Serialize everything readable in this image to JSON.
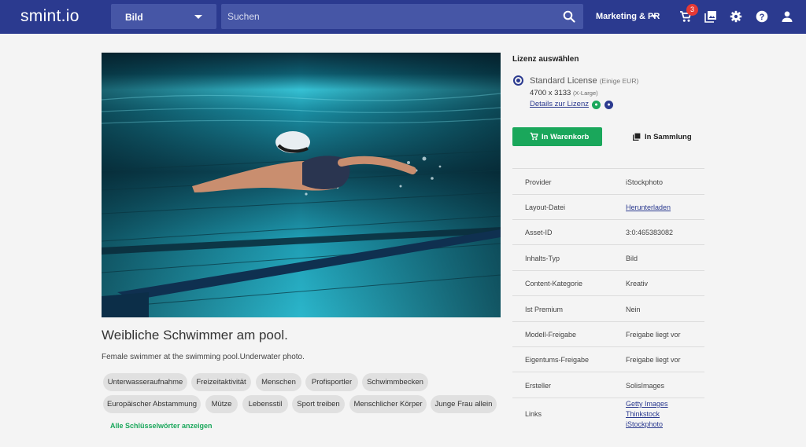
{
  "header": {
    "logo": "smint.io",
    "type_select": "Bild",
    "search_placeholder": "Suchen",
    "workspace": "Marketing & PR",
    "cart_count": "3"
  },
  "asset": {
    "title": "Weibliche Schwimmer am pool.",
    "description": "Female swimmer at the swimming pool.Underwater photo.",
    "keywords": [
      "Unterwasseraufnahme",
      "Freizeitaktivität",
      "Menschen",
      "Profisportler",
      "Schwimmbecken",
      "Europäischer Abstammung",
      "Mütze",
      "Lebensstil",
      "Sport treiben",
      "Menschlicher Körper",
      "Junge Frau allein"
    ],
    "all_keywords_link": "Alle Schlüsselwörter anzeigen"
  },
  "license": {
    "heading": "Lizenz auswählen",
    "name": "Standard License",
    "price_note": "(Einige EUR)",
    "size": "4700 x 3133",
    "size_note": "(X-Large)",
    "details_link": "Details zur Lizenz",
    "cart_button": "In Warenkorb",
    "collection_button": "In Sammlung"
  },
  "details": {
    "rows": [
      {
        "key": "Provider",
        "value": "iStockphoto"
      },
      {
        "key": "Layout-Datei",
        "value": "Herunterladen"
      },
      {
        "key": "Asset-ID",
        "value": "3:0:465383082"
      },
      {
        "key": "Inhalts-Typ",
        "value": "Bild"
      },
      {
        "key": "Content-Kategorie",
        "value": "Kreativ"
      },
      {
        "key": "Ist Premium",
        "value": "Nein"
      },
      {
        "key": "Modell-Freigabe",
        "value": "Freigabe liegt vor"
      },
      {
        "key": "Eigentums-Freigabe",
        "value": "Freigabe liegt vor"
      },
      {
        "key": "Ersteller",
        "value": "SolisImages"
      }
    ],
    "links_label": "Links",
    "links": [
      "Getty Images",
      "Thinkstock",
      "iStockphoto"
    ]
  },
  "colors": {
    "topbar": "#2b3a8f",
    "accent_green": "#1aa75b",
    "badge_red": "#e53935"
  }
}
